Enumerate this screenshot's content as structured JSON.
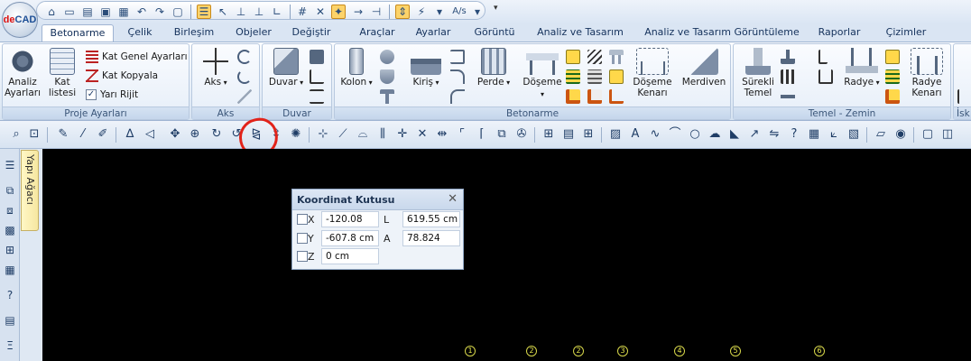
{
  "app": {
    "logo_text": "deCAD"
  },
  "ribbon_tabs": [
    {
      "label": "Betonarme",
      "active": true
    },
    {
      "label": "Çelik"
    },
    {
      "label": "Birleşim"
    },
    {
      "label": "Objeler"
    },
    {
      "label": "Değiştir"
    },
    {
      "label": "Araçlar"
    },
    {
      "label": "Ayarlar"
    },
    {
      "label": "Görüntü"
    },
    {
      "label": "Analiz ve Tasarım"
    },
    {
      "label": "Analiz ve Tasarım Görüntüleme"
    },
    {
      "label": "Raporlar"
    },
    {
      "label": "Çizimler"
    }
  ],
  "groups": {
    "proje_ayarlari": {
      "label": "Proje Ayarları",
      "analiz_ayarlari": "Analiz\nAyarları",
      "kat_listesi": "Kat\nlistesi",
      "kat_genel_ayarlari": "Kat Genel Ayarları",
      "kat_kopyala": "Kat Kopyala",
      "yari_rijit": "Yarı Rijit",
      "yari_rijit_checked": true
    },
    "aks": {
      "label": "Aks",
      "aks_button": "Aks"
    },
    "duvar": {
      "label": "Duvar",
      "duvar_button": "Duvar"
    },
    "betonarme": {
      "label": "Betonarme",
      "kolon": "Kolon",
      "kiris": "Kiriş",
      "perde": "Perde",
      "doseme": "Döşeme",
      "doseme_kenari": "Döşeme\nKenarı",
      "merdiven": "Merdiven"
    },
    "temel_zemin": {
      "label": "Temel - Zemin",
      "surekli_temel": "Sürekli\nTemel",
      "radye": "Radye",
      "radye_kenari": "Radye\nKenarı"
    },
    "iskele": {
      "label": "İsk"
    }
  },
  "left_panel": {
    "tab_label": "Yapı Ağacı"
  },
  "koordinat_kutusu": {
    "title": "Koordinat Kutusu",
    "x_label": "X",
    "x_value": "-120.08 cm",
    "y_label": "Y",
    "y_value": "-607.8 cm",
    "z_label": "Z",
    "z_value": "0 cm",
    "l_label": "L",
    "l_value": "619.55 cm",
    "a_label": "A",
    "a_value": "78.824"
  },
  "axis_markers": [
    "1",
    "2",
    "2",
    "3",
    "4",
    "5",
    "6"
  ],
  "colors": {
    "canvas": "#000000",
    "highlight": "#e2231a",
    "axis_marker": "#e6e64c"
  }
}
